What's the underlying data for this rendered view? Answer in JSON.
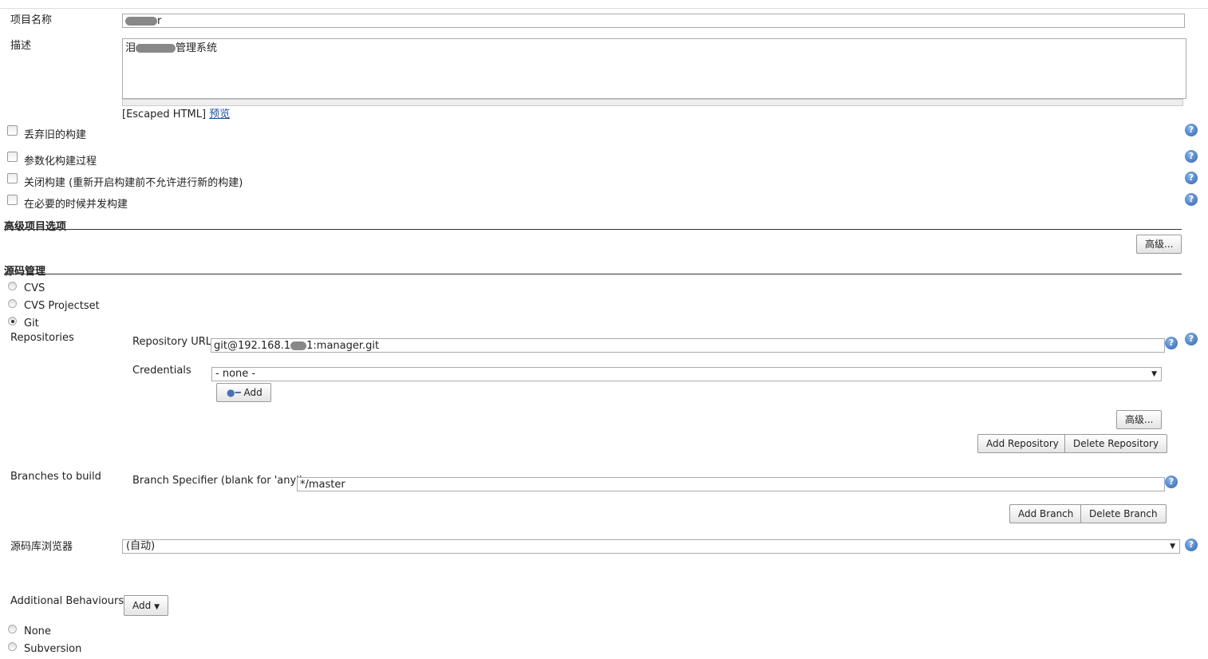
{
  "project": {
    "name_label": "项目名称",
    "name_value_suffix": "r",
    "desc_label": "描述",
    "desc_value_prefix": "泪",
    "desc_value_suffix": "管理系统",
    "escaped_html": "[Escaped HTML]",
    "preview_link": "预览"
  },
  "options": [
    {
      "label": "丢弃旧的构建",
      "checked": false
    },
    {
      "label": "参数化构建过程",
      "checked": false
    },
    {
      "label": "关闭构建 (重新开启构建前不允许进行新的构建)",
      "checked": false
    },
    {
      "label": "在必要的时候并发构建",
      "checked": false
    }
  ],
  "advanced_section": {
    "title": "高级项目选项",
    "button": "高级..."
  },
  "scm": {
    "title": "源码管理",
    "options": [
      {
        "label": "CVS",
        "selected": false
      },
      {
        "label": "CVS Projectset",
        "selected": false
      },
      {
        "label": "Git",
        "selected": true
      }
    ],
    "repositories_label": "Repositories",
    "repo_url_label": "Repository URL",
    "repo_url_prefix": "git@192.168.1",
    "repo_url_suffix": "1:manager.git",
    "credentials_label": "Credentials",
    "credentials_value": "- none -",
    "add_button": "Add",
    "advanced_button": "高级...",
    "add_repository": "Add Repository",
    "delete_repository": "Delete Repository",
    "branches_label": "Branches to build",
    "branch_spec_label": "Branch Specifier (blank for 'any')",
    "branch_spec_value": "*/master",
    "add_branch": "Add Branch",
    "delete_branch": "Delete Branch",
    "browser_label": "源码库浏览器",
    "browser_value": "(自动)",
    "behaviours_label": "Additional Behaviours",
    "behaviours_add": "Add",
    "other_options": [
      {
        "label": "None",
        "selected": false
      },
      {
        "label": "Subversion",
        "selected": false
      }
    ]
  },
  "help_icon": "?"
}
